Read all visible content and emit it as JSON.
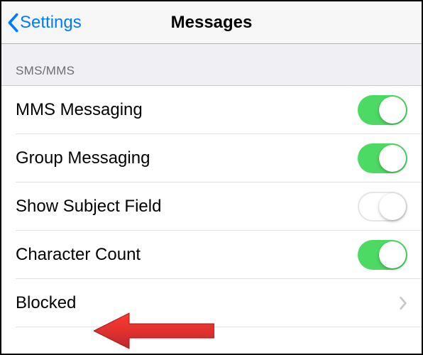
{
  "header": {
    "back_label": "Settings",
    "title": "Messages"
  },
  "section": {
    "header": "SMS/MMS"
  },
  "rows": {
    "mms": {
      "label": "MMS Messaging",
      "on": true
    },
    "group": {
      "label": "Group Messaging",
      "on": true
    },
    "subject": {
      "label": "Show Subject Field",
      "on": false
    },
    "charcount": {
      "label": "Character Count",
      "on": true
    },
    "blocked": {
      "label": "Blocked"
    }
  }
}
